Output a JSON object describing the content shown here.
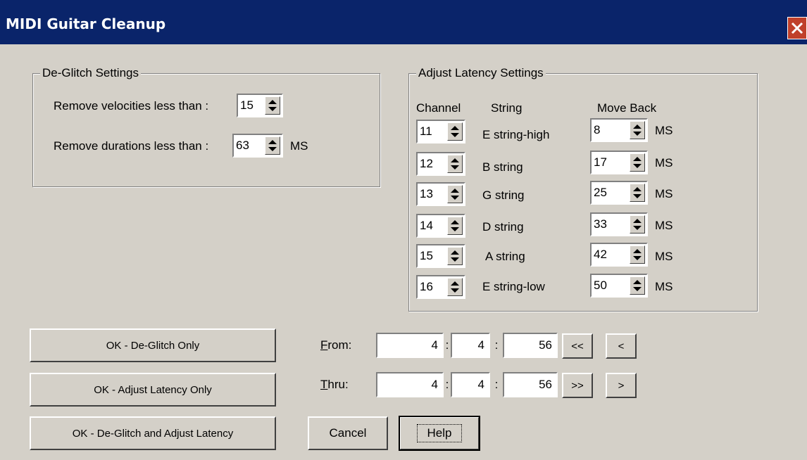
{
  "window": {
    "title": "MIDI Guitar Cleanup"
  },
  "deglitch": {
    "legend": "De-Glitch Settings",
    "velocities_label": "Remove velocities less than :",
    "velocities_value": "15",
    "durations_label": "Remove durations less than :",
    "durations_value": "63",
    "durations_unit": "MS"
  },
  "latency": {
    "legend": "Adjust Latency Settings",
    "headers": {
      "channel": "Channel",
      "string": "String",
      "move_back": "Move Back"
    },
    "rows": [
      {
        "channel": "11",
        "string": "E string-high",
        "move_back": "8",
        "unit": "MS"
      },
      {
        "channel": "12",
        "string": "B string",
        "move_back": "17",
        "unit": "MS"
      },
      {
        "channel": "13",
        "string": "G string",
        "move_back": "25",
        "unit": "MS"
      },
      {
        "channel": "14",
        "string": "D string",
        "move_back": "33",
        "unit": "MS"
      },
      {
        "channel": "15",
        "string": "A string",
        "move_back": "42",
        "unit": "MS"
      },
      {
        "channel": "16",
        "string": "E string-low",
        "move_back": "50",
        "unit": "MS"
      }
    ]
  },
  "range": {
    "from": {
      "label_first": "F",
      "label_rest": "rom:",
      "bar": "4",
      "beat": "4",
      "tick": "56"
    },
    "thru": {
      "label_first": "T",
      "label_rest": "hru:",
      "bar": "4",
      "beat": "4",
      "tick": "56"
    },
    "sep": ":",
    "buttons": {
      "rewind": "<<",
      "prev": "<",
      "fast_forward": ">>",
      "next": ">"
    }
  },
  "buttons": {
    "deglitch_only": "OK - De-Glitch Only",
    "latency_only": "OK - Adjust Latency Only",
    "both": "OK - De-Glitch and Adjust Latency",
    "cancel": "Cancel",
    "help": "Help"
  }
}
